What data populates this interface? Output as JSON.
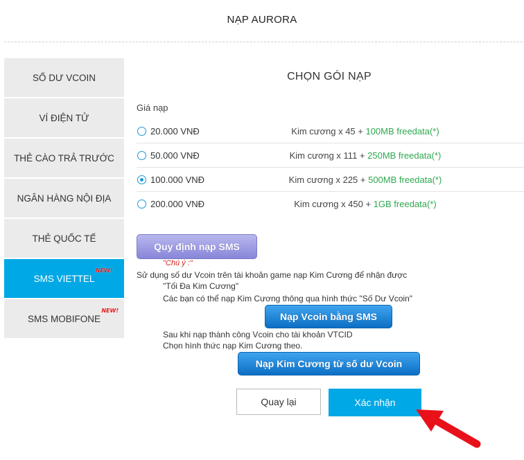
{
  "header": {
    "title": "NẠP AURORA"
  },
  "sidebar": {
    "items": [
      {
        "label": "SỐ DƯ VCOIN",
        "active": false
      },
      {
        "label": "VÍ ĐIỆN TỬ",
        "active": false
      },
      {
        "label": "THẺ CÀO TRẢ TRƯỚC",
        "active": false
      },
      {
        "label": "NGÂN HÀNG NỘI ĐỊA",
        "active": false
      },
      {
        "label": "THẺ QUỐC TẾ",
        "active": false
      },
      {
        "label": "SMS VIETTEL",
        "active": true,
        "badge": "NEW!"
      },
      {
        "label": "SMS MOBIFONE",
        "active": false,
        "badge": "NEW!"
      }
    ]
  },
  "main": {
    "section_title": "CHỌN GÓI NẠP",
    "price_label": "Giá nạp",
    "options": [
      {
        "price": "20.000 VNĐ",
        "desc": "Kim cương x 45 + ",
        "bonus": "100MB freedata(*)",
        "selected": false
      },
      {
        "price": "50.000 VNĐ",
        "desc": "Kim cương x 111 + ",
        "bonus": "250MB freedata(*)",
        "selected": false
      },
      {
        "price": "100.000 VNĐ",
        "desc": "Kim cương x 225 + ",
        "bonus": "500MB freedata(*)",
        "selected": true
      },
      {
        "price": "200.000 VNĐ",
        "desc": "Kim cương x 450 + ",
        "bonus": "1GB freedata(*)",
        "selected": false
      }
    ],
    "rule_button": "Quy định nạp SMS",
    "note_title": "\"Chú ý :\"",
    "note_lines": [
      "Sử dụng số dư Vcoin trên tài khoản game nạp Kim Cương để nhận được",
      "\"Tối Đa Kim Cương\"",
      "Các bạn có thể nạp Kim Cương thông qua hình thức \"Số Dư Vcoin\"",
      "Sau khi nạp thành công Vcoin cho tài khoản VTCID",
      "Chọn hình thức nạp Kim Cương theo."
    ],
    "btn_vcoin_sms": "Nạp Vcoin bằng SMS",
    "btn_kc_vcoin": "Nạp Kim Cương từ số dư Vcoin",
    "btn_back": "Quay lại",
    "btn_confirm": "Xác nhận"
  },
  "colors": {
    "accent": "#00a8e6",
    "bonus_green": "#2fa84f",
    "note_red": "#d0211c",
    "arrow_red": "#e8111a"
  },
  "icons": {
    "annotation_arrow": "red-arrow-icon"
  }
}
